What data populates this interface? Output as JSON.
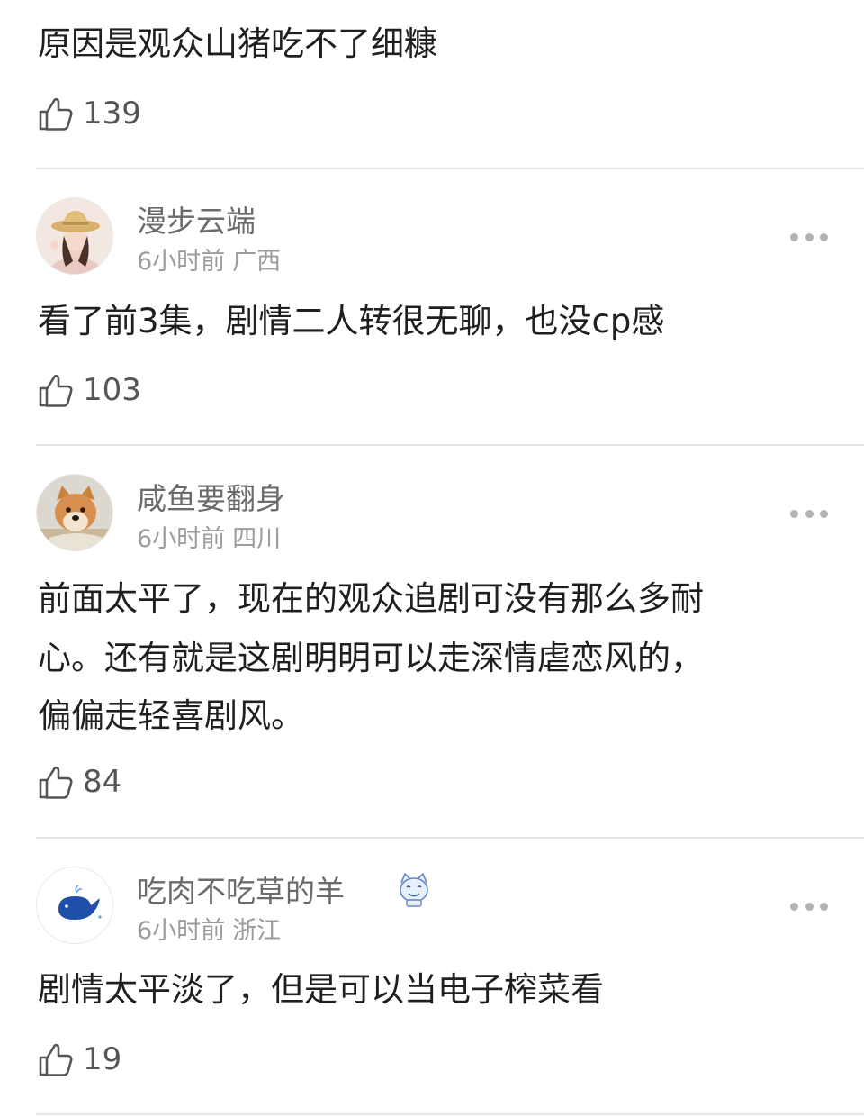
{
  "top_comment": {
    "text": "原因是观众山猪吃不了细糠",
    "likes": "139"
  },
  "comments": [
    {
      "username": "漫步云端",
      "time": "6小时前",
      "location": "广西",
      "text_lines": [
        "看了前3集，剧情二人转很无聊，也没cp感"
      ],
      "likes": "103",
      "avatar_icon": "girl-with-straw-hat-avatar"
    },
    {
      "username": "咸鱼要翻身",
      "time": "6小时前",
      "location": "四川",
      "text_lines": [
        "前面太平了，现在的观众追剧可没有那么多耐",
        "心。还有就是这剧明明可以走深情虐恋风的，",
        "偏偏走轻喜剧风。"
      ],
      "likes": "84",
      "avatar_icon": "shiba-dog-avatar"
    },
    {
      "username": "吃肉不吃草的羊",
      "time": "6小时前",
      "location": "浙江",
      "text_lines": [
        "剧情太平淡了，但是可以当电子榨菜看"
      ],
      "likes": "19",
      "avatar_icon": "blue-whale-avatar",
      "badge_icon": "cat-sticker-icon"
    }
  ],
  "icons": {
    "like": "thumbs-up-icon",
    "more": "more-dots-icon"
  },
  "colors": {
    "divider": "#e6e6e6",
    "username": "#6b6b6b",
    "meta": "#9c9c9c",
    "text": "#1f1f1f",
    "whale": "#1f4fa8"
  }
}
